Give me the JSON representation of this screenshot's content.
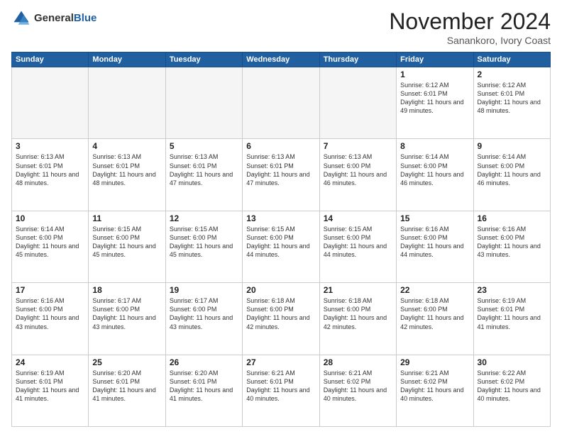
{
  "header": {
    "logo_general": "General",
    "logo_blue": "Blue",
    "month_title": "November 2024",
    "location": "Sanankoro, Ivory Coast"
  },
  "weekdays": [
    "Sunday",
    "Monday",
    "Tuesday",
    "Wednesday",
    "Thursday",
    "Friday",
    "Saturday"
  ],
  "weeks": [
    [
      {
        "day": "",
        "text": ""
      },
      {
        "day": "",
        "text": ""
      },
      {
        "day": "",
        "text": ""
      },
      {
        "day": "",
        "text": ""
      },
      {
        "day": "",
        "text": ""
      },
      {
        "day": "1",
        "text": "Sunrise: 6:12 AM\nSunset: 6:01 PM\nDaylight: 11 hours and 49 minutes."
      },
      {
        "day": "2",
        "text": "Sunrise: 6:12 AM\nSunset: 6:01 PM\nDaylight: 11 hours and 48 minutes."
      }
    ],
    [
      {
        "day": "3",
        "text": "Sunrise: 6:13 AM\nSunset: 6:01 PM\nDaylight: 11 hours and 48 minutes."
      },
      {
        "day": "4",
        "text": "Sunrise: 6:13 AM\nSunset: 6:01 PM\nDaylight: 11 hours and 48 minutes."
      },
      {
        "day": "5",
        "text": "Sunrise: 6:13 AM\nSunset: 6:01 PM\nDaylight: 11 hours and 47 minutes."
      },
      {
        "day": "6",
        "text": "Sunrise: 6:13 AM\nSunset: 6:01 PM\nDaylight: 11 hours and 47 minutes."
      },
      {
        "day": "7",
        "text": "Sunrise: 6:13 AM\nSunset: 6:00 PM\nDaylight: 11 hours and 46 minutes."
      },
      {
        "day": "8",
        "text": "Sunrise: 6:14 AM\nSunset: 6:00 PM\nDaylight: 11 hours and 46 minutes."
      },
      {
        "day": "9",
        "text": "Sunrise: 6:14 AM\nSunset: 6:00 PM\nDaylight: 11 hours and 46 minutes."
      }
    ],
    [
      {
        "day": "10",
        "text": "Sunrise: 6:14 AM\nSunset: 6:00 PM\nDaylight: 11 hours and 45 minutes."
      },
      {
        "day": "11",
        "text": "Sunrise: 6:15 AM\nSunset: 6:00 PM\nDaylight: 11 hours and 45 minutes."
      },
      {
        "day": "12",
        "text": "Sunrise: 6:15 AM\nSunset: 6:00 PM\nDaylight: 11 hours and 45 minutes."
      },
      {
        "day": "13",
        "text": "Sunrise: 6:15 AM\nSunset: 6:00 PM\nDaylight: 11 hours and 44 minutes."
      },
      {
        "day": "14",
        "text": "Sunrise: 6:15 AM\nSunset: 6:00 PM\nDaylight: 11 hours and 44 minutes."
      },
      {
        "day": "15",
        "text": "Sunrise: 6:16 AM\nSunset: 6:00 PM\nDaylight: 11 hours and 44 minutes."
      },
      {
        "day": "16",
        "text": "Sunrise: 6:16 AM\nSunset: 6:00 PM\nDaylight: 11 hours and 43 minutes."
      }
    ],
    [
      {
        "day": "17",
        "text": "Sunrise: 6:16 AM\nSunset: 6:00 PM\nDaylight: 11 hours and 43 minutes."
      },
      {
        "day": "18",
        "text": "Sunrise: 6:17 AM\nSunset: 6:00 PM\nDaylight: 11 hours and 43 minutes."
      },
      {
        "day": "19",
        "text": "Sunrise: 6:17 AM\nSunset: 6:00 PM\nDaylight: 11 hours and 43 minutes."
      },
      {
        "day": "20",
        "text": "Sunrise: 6:18 AM\nSunset: 6:00 PM\nDaylight: 11 hours and 42 minutes."
      },
      {
        "day": "21",
        "text": "Sunrise: 6:18 AM\nSunset: 6:00 PM\nDaylight: 11 hours and 42 minutes."
      },
      {
        "day": "22",
        "text": "Sunrise: 6:18 AM\nSunset: 6:00 PM\nDaylight: 11 hours and 42 minutes."
      },
      {
        "day": "23",
        "text": "Sunrise: 6:19 AM\nSunset: 6:01 PM\nDaylight: 11 hours and 41 minutes."
      }
    ],
    [
      {
        "day": "24",
        "text": "Sunrise: 6:19 AM\nSunset: 6:01 PM\nDaylight: 11 hours and 41 minutes."
      },
      {
        "day": "25",
        "text": "Sunrise: 6:20 AM\nSunset: 6:01 PM\nDaylight: 11 hours and 41 minutes."
      },
      {
        "day": "26",
        "text": "Sunrise: 6:20 AM\nSunset: 6:01 PM\nDaylight: 11 hours and 41 minutes."
      },
      {
        "day": "27",
        "text": "Sunrise: 6:21 AM\nSunset: 6:01 PM\nDaylight: 11 hours and 40 minutes."
      },
      {
        "day": "28",
        "text": "Sunrise: 6:21 AM\nSunset: 6:02 PM\nDaylight: 11 hours and 40 minutes."
      },
      {
        "day": "29",
        "text": "Sunrise: 6:21 AM\nSunset: 6:02 PM\nDaylight: 11 hours and 40 minutes."
      },
      {
        "day": "30",
        "text": "Sunrise: 6:22 AM\nSunset: 6:02 PM\nDaylight: 11 hours and 40 minutes."
      }
    ]
  ]
}
